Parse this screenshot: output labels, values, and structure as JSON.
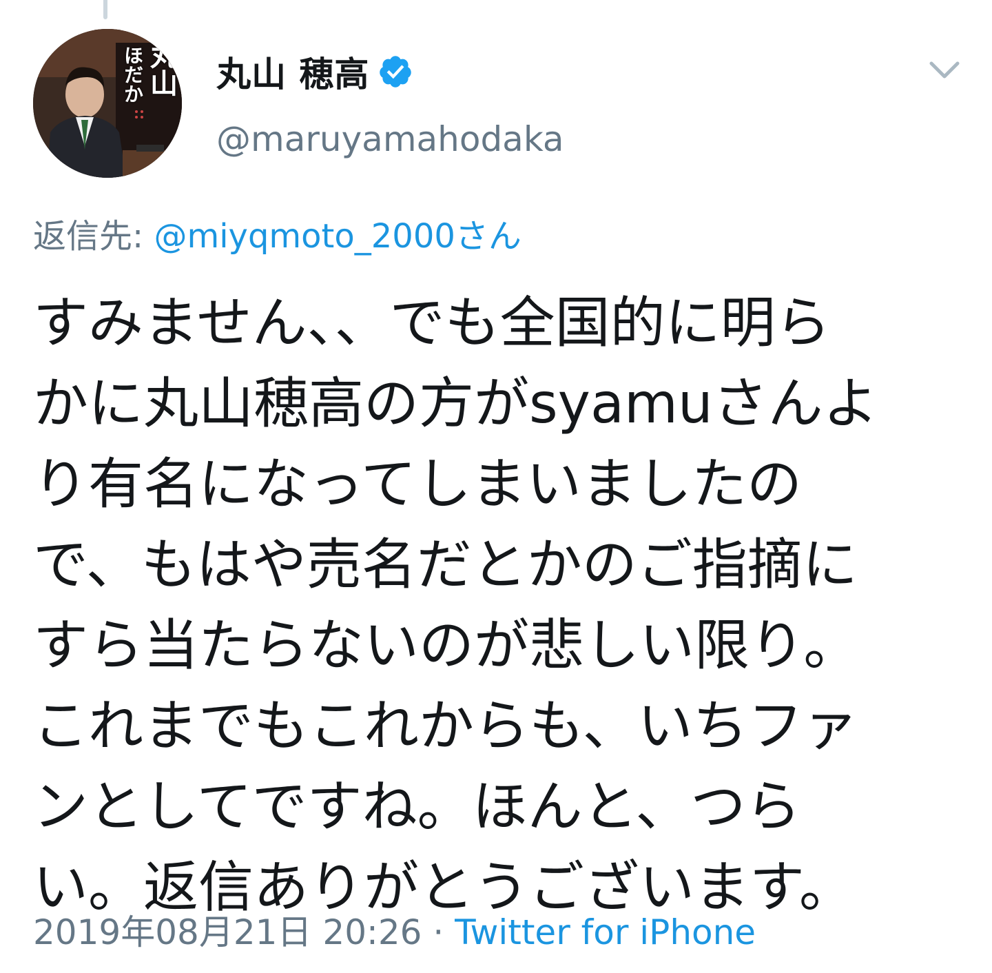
{
  "tweet": {
    "author": {
      "display_name": "丸山 穂高",
      "handle": "@maruyamahodaka",
      "avatar_overlay_text": [
        "丸山",
        "ほだか"
      ]
    },
    "reply": {
      "label": "返信先:",
      "mention": "@miyqmoto_2000さん"
    },
    "text_lines": [
      "すみません、、でも全国的に明ら",
      "かに丸山穂高の方がsyamuさんよ",
      "り有名になってしまいましたの",
      "で、もはや売名だとかのご指摘に",
      "すら当たらないのが悲しい限り。",
      "これまでもこれからも、いちファ",
      "ンとしてですね。ほんと、つら",
      "い。返信ありがとうございます。"
    ],
    "timestamp": "2019年08月21日 20:26",
    "separator": " · ",
    "source": "Twitter for iPhone"
  },
  "icons": {
    "verified": "verified-badge-icon",
    "more": "chevron-down-icon"
  },
  "colors": {
    "link": "#1b95e0",
    "secondary_text": "#657786",
    "primary_text": "#14171a",
    "verified": "#1da1f2"
  }
}
